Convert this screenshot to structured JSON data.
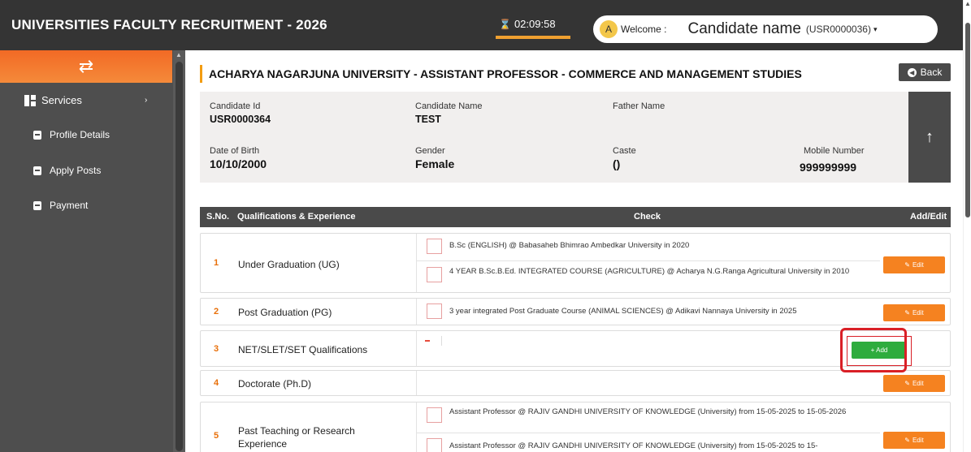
{
  "header": {
    "title": "UNIVERSITIES FACULTY RECRUITMENT - 2026",
    "timer": "02:09:58",
    "welcome_label": "Welcome :",
    "candidate_name": "Candidate name",
    "candidate_id": "(USR0000036)",
    "avatar_letter": "A"
  },
  "sidebar": {
    "services_label": "Services",
    "items": [
      {
        "label": "Profile Details"
      },
      {
        "label": "Apply Posts"
      },
      {
        "label": "Payment"
      }
    ]
  },
  "main": {
    "post_title": "ACHARYA NAGARJUNA UNIVERSITY - ASSISTANT PROFESSOR - COMMERCE AND MANAGEMENT STUDIES",
    "back_label": "Back",
    "candidate": {
      "id_label": "Candidate Id",
      "id_value": "USR0000364",
      "name_label": "Candidate Name",
      "name_value": "TEST",
      "father_label": "Father Name",
      "father_value": "",
      "dob_label": "Date of Birth",
      "dob_value": "10/10/2000",
      "gender_label": "Gender",
      "gender_value": "Female",
      "caste_label": "Caste",
      "caste_value": "()",
      "mobile_label": "Mobile Number",
      "mobile_value": "999999999"
    },
    "table": {
      "headers": [
        "S.No.",
        "Qualifications & Experience",
        "Check",
        "Add/Edit"
      ],
      "rows": [
        {
          "sno": "1",
          "qualification": "Under Graduation (UG)",
          "checks": [
            "B.Sc (ENGLISH) @ Babasaheb Bhimrao Ambedkar University in 2020",
            "4 YEAR B.Sc.B.Ed. INTEGRATED COURSE (AGRICULTURE) @ Acharya N.G.Ranga Agricultural University in 2010"
          ],
          "action": "Edit"
        },
        {
          "sno": "2",
          "qualification": "Post Graduation (PG)",
          "checks": [
            "3 year integrated Post Graduate Course (ANIMAL SCIENCES) @ Adikavi Nannaya University in 2025"
          ],
          "action": "Edit"
        },
        {
          "sno": "3",
          "qualification": "NET/SLET/SET Qualifications",
          "checks": [],
          "action": "+ Add"
        },
        {
          "sno": "4",
          "qualification": "Doctorate (Ph.D)",
          "checks": [],
          "action": "Edit"
        },
        {
          "sno": "5",
          "qualification": "Past Teaching or Research Experience",
          "checks": [
            "Assistant Professor @ RAJIV GANDHI UNIVERSITY OF KNOWLEDGE (University) from 15-05-2025 to 15-05-2026",
            "Assistant Professor @ RAJIV GANDHI UNIVERSITY OF KNOWLEDGE (University) from 15-05-2025 to 15-"
          ],
          "action": "Edit"
        }
      ]
    }
  },
  "colors": {
    "accent_orange": "#f58220",
    "add_green": "#2eac3e",
    "highlight_red": "#d91f26",
    "dark": "#343434"
  },
  "icons": [
    "swap-arrows-icon",
    "grid-icon",
    "chevron-right-icon",
    "document-icon",
    "hourglass-icon",
    "user-icon",
    "chevron-down-icon",
    "back-arrow-icon",
    "arrow-up-icon",
    "edit-icon"
  ]
}
